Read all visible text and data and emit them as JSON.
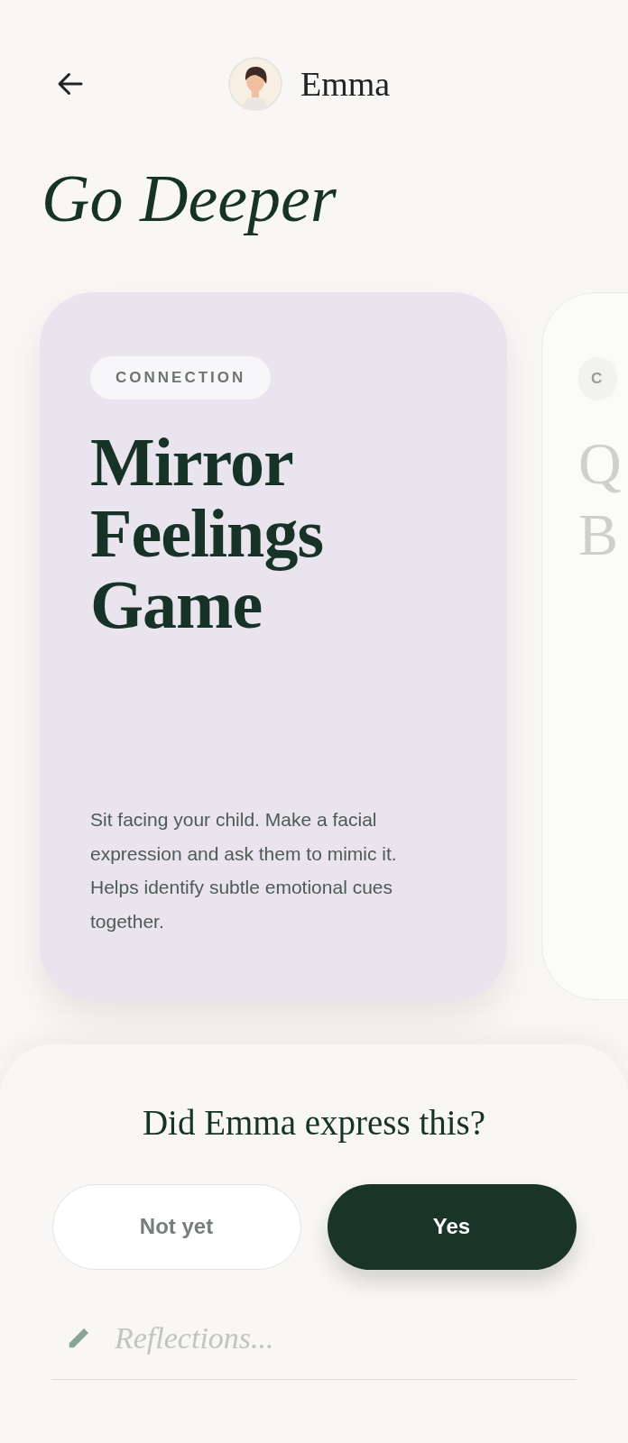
{
  "header": {
    "name": "Emma"
  },
  "title": "Go Deeper",
  "cards": [
    {
      "tag": "CONNECTION",
      "title_lines": [
        "Mirror",
        "Feelings",
        "Game"
      ],
      "description": "Sit facing your child. Make a facial expression and ask them to mimic it. Helps identify subtle emotional cues together.",
      "selected": true
    },
    {
      "tag": "C",
      "title_lines": [
        "Q",
        "B"
      ],
      "selected": false
    }
  ],
  "question": "Did Emma express this?",
  "options": [
    {
      "label": "Not yet",
      "selected": false
    },
    {
      "label": "Yes",
      "selected": true
    }
  ],
  "reflection": {
    "placeholder": "Reflections..."
  }
}
